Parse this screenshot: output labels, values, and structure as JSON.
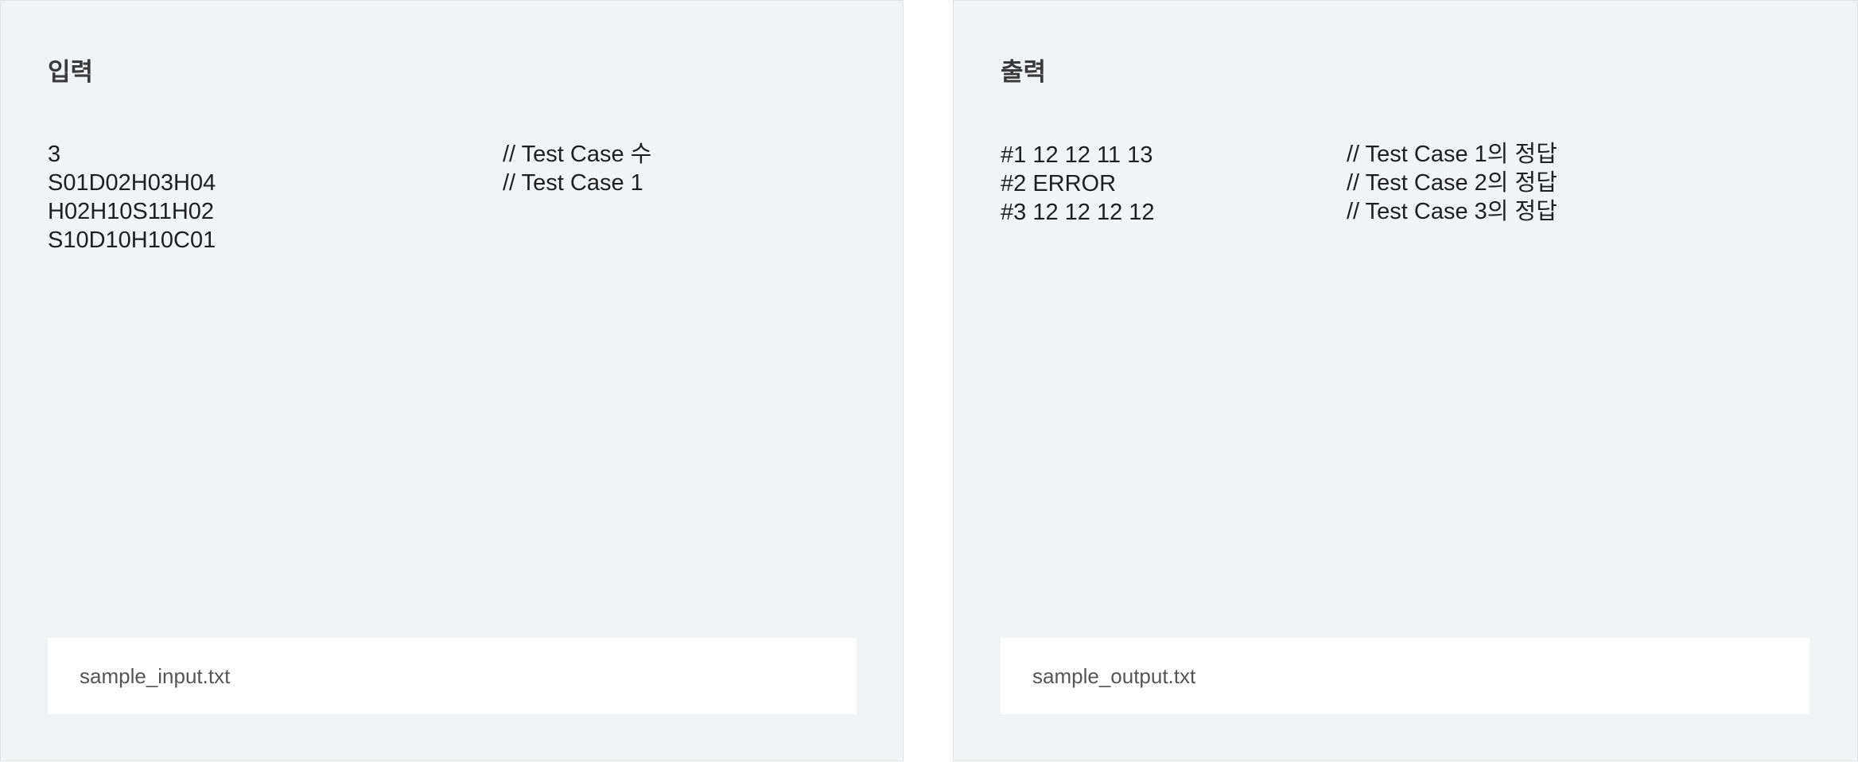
{
  "input_panel": {
    "title": "입력",
    "lines": [
      "3",
      "S01D02H03H04",
      "H02H10S11H02",
      "S10D10H10C01"
    ],
    "comments": [
      "// Test Case 수",
      "// Test Case 1"
    ],
    "file_name": "sample_input.txt"
  },
  "output_panel": {
    "title": "출력",
    "lines": [
      "#1 12 12 11 13",
      "#2 ERROR",
      "#3 12 12 12 12"
    ],
    "comments": [
      "// Test Case 1의 정답",
      "// Test Case 2의 정답",
      "// Test Case 3의 정답"
    ],
    "file_name": "sample_output.txt"
  }
}
